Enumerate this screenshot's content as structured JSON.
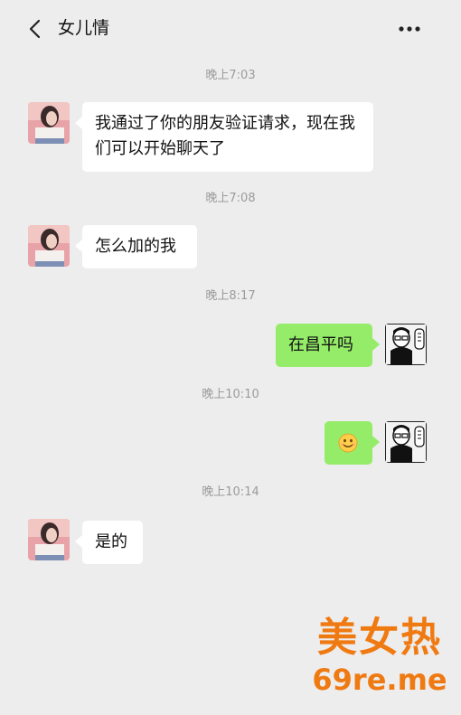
{
  "header": {
    "title": "女儿情",
    "back_icon": "chevron-left-icon",
    "more_icon": "more-dots-icon"
  },
  "messages": [
    {
      "time": "晚上7:03",
      "side": "left",
      "text": "我通过了你的朋友验证请求，现在我们可以开始聊天了"
    },
    {
      "time": "晚上7:08",
      "side": "left",
      "text": "怎么加的我"
    },
    {
      "time": "晚上8:17",
      "side": "right",
      "text": "在昌平吗"
    },
    {
      "time": "晚上10:10",
      "side": "right",
      "text": "",
      "emoji": "smile-emoji-icon"
    },
    {
      "time": "晚上10:14",
      "side": "left",
      "text": "是的"
    }
  ],
  "watermark": {
    "line1": "美女热",
    "line2": "69re.me",
    "color": "#f07a12"
  },
  "colors": {
    "background": "#ededed",
    "bubble_right": "#95ec69",
    "bubble_left": "#ffffff"
  }
}
